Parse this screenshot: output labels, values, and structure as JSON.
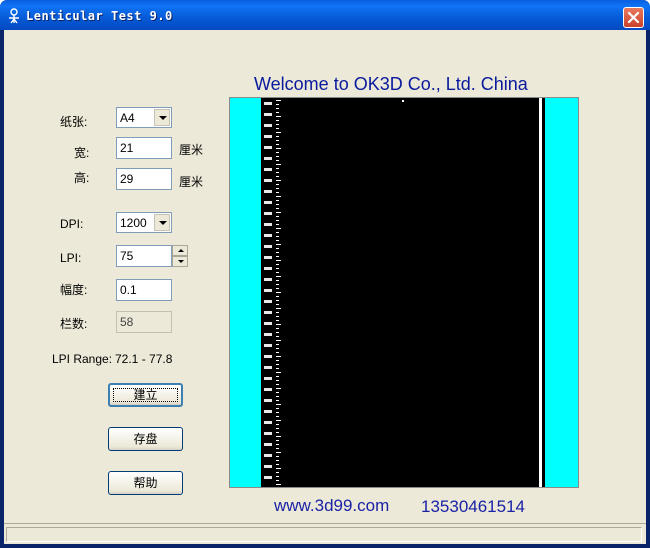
{
  "window": {
    "title": "Lenticular Test 9.0"
  },
  "form": {
    "paper_label": "纸张:",
    "paper_value": "A4",
    "width_label": "宽:",
    "width_value": "21",
    "width_unit": "厘米",
    "height_label": "高:",
    "height_value": "29",
    "height_unit": "厘米",
    "dpi_label": "DPI:",
    "dpi_value": "1200",
    "lpi_label": "LPI:",
    "lpi_value": "75",
    "amplitude_label": "幅度:",
    "amplitude_value": "0.1",
    "columns_label": "栏数:",
    "columns_value": "58",
    "lpi_range_label": "LPI Range:",
    "lpi_range_value": "72.1 - 77.8"
  },
  "buttons": {
    "build": "建立",
    "save": "存盘",
    "help": "帮助"
  },
  "banner": {
    "welcome": "Welcome to OK3D Co., Ltd. China",
    "website": "www.3d99.com",
    "phone": "13530461514"
  },
  "preview": {
    "left_band_color": "#00ffff",
    "right_band_color": "#00ffff",
    "background_color": "#000000"
  }
}
